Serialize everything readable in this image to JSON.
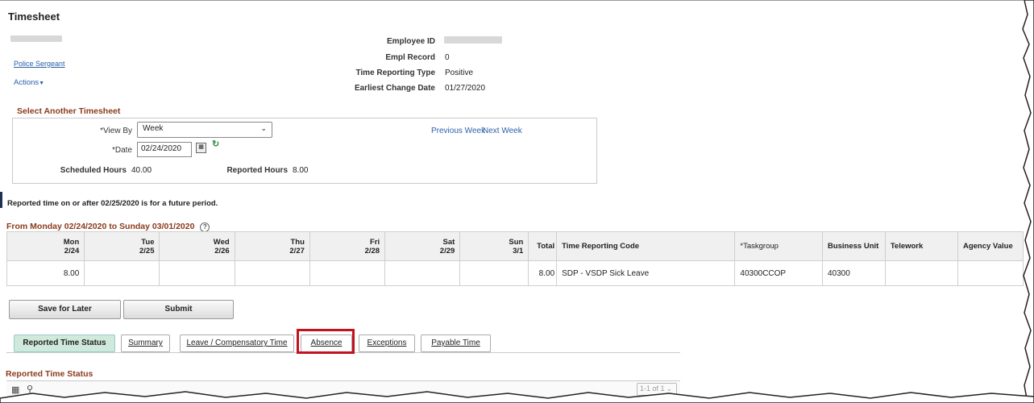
{
  "page": {
    "title": "Timesheet"
  },
  "employee": {
    "job_title": "Police Sergeant",
    "actions_label": "Actions",
    "fields": [
      {
        "label": "Employee ID",
        "value": ""
      },
      {
        "label": "Empl Record",
        "value": "0"
      },
      {
        "label": "Time Reporting Type",
        "value": "Positive"
      },
      {
        "label": "Earliest Change Date",
        "value": "01/27/2020"
      }
    ]
  },
  "select_timesheet": {
    "heading": "Select Another Timesheet",
    "view_by_label": "*View By",
    "view_by_value": "Week",
    "date_label": "*Date",
    "date_value": "02/24/2020",
    "previous_week": "Previous Week",
    "next_week": "Next Week",
    "scheduled_hours_label": "Scheduled Hours",
    "scheduled_hours_value": "40.00",
    "reported_hours_label": "Reported Hours",
    "reported_hours_value": "8.00"
  },
  "notice": "Reported time on or after 02/25/2020 is for a future period.",
  "period": {
    "heading": "From Monday 02/24/2020 to Sunday 03/01/2020"
  },
  "grid": {
    "days": [
      {
        "day": "Mon",
        "date": "2/24"
      },
      {
        "day": "Tue",
        "date": "2/25"
      },
      {
        "day": "Wed",
        "date": "2/26"
      },
      {
        "day": "Thu",
        "date": "2/27"
      },
      {
        "day": "Fri",
        "date": "2/28"
      },
      {
        "day": "Sat",
        "date": "2/29"
      },
      {
        "day": "Sun",
        "date": "3/1"
      }
    ],
    "headers": {
      "total": "Total",
      "trc": "Time Reporting Code",
      "taskgroup": "*Taskgroup",
      "business_unit": "Business Unit",
      "telework": "Telework",
      "agency_value": "Agency Value"
    },
    "row": {
      "hours": [
        "8.00",
        "",
        "",
        "",
        "",
        "",
        ""
      ],
      "total": "8.00",
      "trc": "SDP - VSDP Sick Leave",
      "taskgroup": "40300CCOP",
      "business_unit": "40300",
      "telework": "",
      "agency_value": ""
    }
  },
  "buttons": {
    "save_for_later": "Save for Later",
    "submit": "Submit"
  },
  "tabs": [
    {
      "label": "Reported Time Status",
      "active": true
    },
    {
      "label": "Summary",
      "active": false
    },
    {
      "label": "Leave / Compensatory Time",
      "active": false
    },
    {
      "label": "Absence",
      "active": false,
      "highlighted": true
    },
    {
      "label": "Exceptions",
      "active": false
    },
    {
      "label": "Payable Time",
      "active": false
    }
  ],
  "status_section": {
    "heading": "Reported Time Status",
    "pagination": "1-1 of 1"
  },
  "colors": {
    "accent_brown": "#8c3a1c",
    "link_blue": "#2a5fa8",
    "active_tab_green": "#cfe9dc",
    "highlight_red": "#c1121f"
  }
}
